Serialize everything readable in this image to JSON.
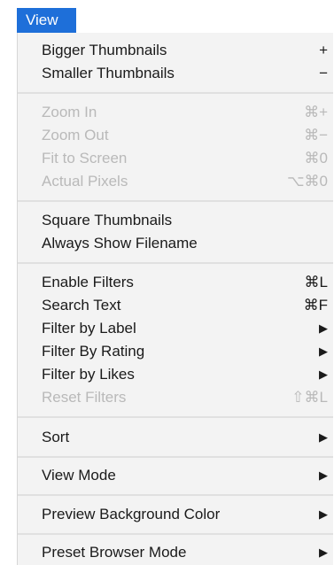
{
  "menu_title": "View",
  "items": [
    {
      "label": "Bigger Thumbnails",
      "shortcut": "+",
      "disabled": false,
      "submenu": false
    },
    {
      "label": "Smaller Thumbnails",
      "shortcut": "−",
      "disabled": false,
      "submenu": false
    },
    {
      "label": "Zoom In",
      "shortcut": "⌘+",
      "disabled": true,
      "submenu": false
    },
    {
      "label": "Zoom Out",
      "shortcut": "⌘−",
      "disabled": true,
      "submenu": false
    },
    {
      "label": "Fit to Screen",
      "shortcut": "⌘0",
      "disabled": true,
      "submenu": false
    },
    {
      "label": "Actual Pixels",
      "shortcut": "⌥⌘0",
      "disabled": true,
      "submenu": false
    },
    {
      "label": "Square Thumbnails",
      "shortcut": "",
      "disabled": false,
      "submenu": false
    },
    {
      "label": "Always Show Filename",
      "shortcut": "",
      "disabled": false,
      "submenu": false
    },
    {
      "label": "Enable Filters",
      "shortcut": "⌘L",
      "disabled": false,
      "submenu": false
    },
    {
      "label": "Search Text",
      "shortcut": "⌘F",
      "disabled": false,
      "submenu": false
    },
    {
      "label": "Filter by Label",
      "shortcut": "",
      "disabled": false,
      "submenu": true
    },
    {
      "label": "Filter By Rating",
      "shortcut": "",
      "disabled": false,
      "submenu": true
    },
    {
      "label": "Filter by Likes",
      "shortcut": "",
      "disabled": false,
      "submenu": true
    },
    {
      "label": "Reset Filters",
      "shortcut": "⇧⌘L",
      "disabled": true,
      "submenu": false
    },
    {
      "label": "Sort",
      "shortcut": "",
      "disabled": false,
      "submenu": true
    },
    {
      "label": "View Mode",
      "shortcut": "",
      "disabled": false,
      "submenu": true
    },
    {
      "label": "Preview Background Color",
      "shortcut": "",
      "disabled": false,
      "submenu": true
    },
    {
      "label": "Preset Browser Mode",
      "shortcut": "",
      "disabled": false,
      "submenu": true
    }
  ],
  "submenu_arrow": "▶",
  "colors": {
    "accent": "#1e6fd9",
    "menu_bg": "#f3f3f3",
    "disabled_text": "#b9b9b9"
  }
}
